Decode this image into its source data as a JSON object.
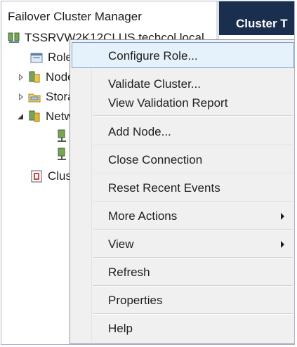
{
  "tree": {
    "title": "Failover Cluster Manager",
    "cluster_node_label": "TSSRVW2K12CLUS.techcol.local",
    "items": [
      {
        "label": "Roles"
      },
      {
        "label": "Nodes"
      },
      {
        "label": "Storage"
      },
      {
        "label": "Networks"
      },
      {
        "label": "Cluster Events"
      }
    ]
  },
  "right_pane": {
    "header_title": "Cluster T"
  },
  "context_menu": {
    "items": [
      {
        "label": "Configure Role...",
        "highlighted": true
      },
      {
        "label": "Validate Cluster..."
      },
      {
        "label": "View Validation Report"
      },
      {
        "label": "Add Node..."
      },
      {
        "label": "Close Connection"
      },
      {
        "label": "Reset Recent Events"
      },
      {
        "label": "More Actions",
        "submenu": true
      },
      {
        "label": "View",
        "submenu": true
      },
      {
        "label": "Refresh"
      },
      {
        "label": "Properties"
      },
      {
        "label": "Help"
      }
    ]
  },
  "colors": {
    "header_bg": "#1a2f4e",
    "menu_bg": "#f0f0f0",
    "highlight_bg": "#e5f1fb",
    "highlight_border": "#7da2ce"
  }
}
